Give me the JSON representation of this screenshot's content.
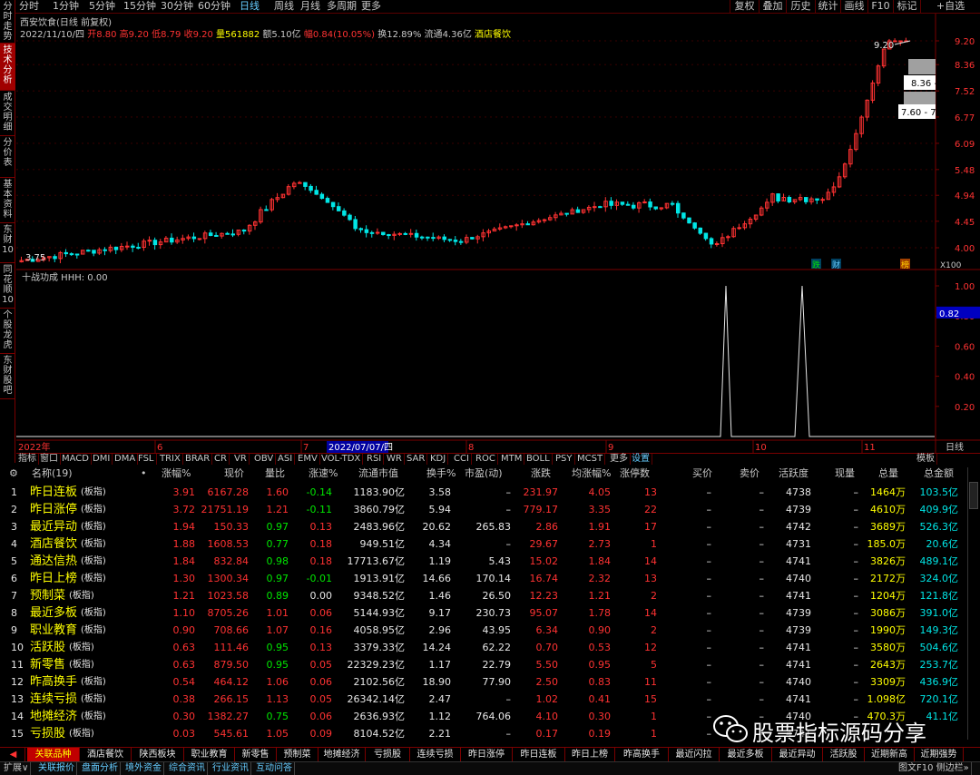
{
  "toolbar": {
    "left_tabs": [
      "分时",
      "1分钟",
      "5分钟",
      "15分钟",
      "30分钟",
      "60分钟",
      "日线",
      "周线",
      "月线",
      "多周期",
      "更多"
    ],
    "selected": "日线",
    "right_buttons": [
      "复权",
      "叠加",
      "历史",
      "统计",
      "画线",
      "F10",
      "标记",
      "+自选"
    ]
  },
  "left_tabs": [
    "分时走势",
    "技术分析",
    "成交明细",
    "分价表",
    "基本资料",
    "东财10",
    "同花顺10",
    "个股龙虎",
    "东财股吧"
  ],
  "left_tab_selected": "技术分析",
  "stock": {
    "title": "西安饮食(日线 前复权)",
    "date": "2022/11/10/四",
    "open_label": "开",
    "open": "8.80",
    "high_label": "高",
    "high": "9.20",
    "low_label": "低",
    "low": "8.79",
    "close_label": "收",
    "close": "9.20",
    "volume_label": "量",
    "volume": "561882",
    "amount_label": "额",
    "amount": "5.10亿",
    "change_label": "幅",
    "change": "0.84(10.05%)",
    "turnover_label": "换",
    "turnover": "12.89%",
    "float_label": "流通",
    "float": "4.36亿",
    "sector": "酒店餐饮"
  },
  "price_axis": [
    "9.20",
    "8.36",
    "7.52",
    "6.77",
    "6.09",
    "5.48",
    "4.94",
    "4.45",
    "4.00"
  ],
  "price_axis_note": "X100",
  "annotations": {
    "high": "9.20",
    "low": "3.75",
    "box1": "8.36 -",
    "box2": "7.60 - 7."
  },
  "markers": [
    "跌",
    "财",
    "榜"
  ],
  "indicator": {
    "title": "十战功成 HHH: 0.00",
    "axis": [
      "1.00",
      "0.82",
      "0.80",
      "0.60",
      "0.40",
      "0.20"
    ],
    "current": "0.82"
  },
  "date_axis": {
    "year": "2022年",
    "labels": [
      "6",
      "7",
      "2022/07/07/四",
      "8",
      "9",
      "10",
      "11"
    ],
    "period": "日线"
  },
  "indicator_tabs": [
    "指标",
    "窗口",
    "MACD",
    "DMI",
    "DMA",
    "FSL",
    "TRIX",
    "BRAR",
    "CR",
    "VR",
    "OBV",
    "ASI",
    "EMV",
    "VOL-TDX",
    "RSI",
    "WR",
    "SAR",
    "KDJ",
    "CCI",
    "ROC",
    "MTM",
    "BOLL",
    "PSY",
    "MCST",
    "更多",
    "设置"
  ],
  "indicator_tab_right": "模板",
  "table": {
    "headers": [
      "名称(19)",
      "•",
      "涨幅%",
      "现价",
      "量比",
      "涨速%",
      "流通市值",
      "换手%",
      "市盈(动)",
      "涨跌",
      "均涨幅%",
      "涨停数",
      "买价",
      "卖价",
      "活跃度",
      "现量",
      "总量",
      "总金额"
    ],
    "rows": [
      {
        "no": "1",
        "name": "昨日连板",
        "tag": "(板指)",
        "chg": "3.91",
        "price": "6167.28",
        "vr": "1.60",
        "speed": "-0.14",
        "mcap": "1183.90亿",
        "turn": "3.58",
        "pe": "–",
        "diff": "231.97",
        "avg": "4.05",
        "zt": "13",
        "bid": "–",
        "ask": "–",
        "act": "4738",
        "vol": "–",
        "tv": "1464万",
        "amt": "103.5亿"
      },
      {
        "no": "2",
        "name": "昨日涨停",
        "tag": "(板指)",
        "chg": "3.72",
        "price": "21751.19",
        "vr": "1.21",
        "speed": "-0.11",
        "mcap": "3860.79亿",
        "turn": "5.94",
        "pe": "–",
        "diff": "779.17",
        "avg": "3.35",
        "zt": "22",
        "bid": "–",
        "ask": "–",
        "act": "4739",
        "vol": "–",
        "tv": "4610万",
        "amt": "409.9亿"
      },
      {
        "no": "3",
        "name": "最近异动",
        "tag": "(板指)",
        "chg": "1.94",
        "price": "150.33",
        "vr": "0.97",
        "speed": "0.13",
        "mcap": "2483.96亿",
        "turn": "20.62",
        "pe": "265.83",
        "diff": "2.86",
        "avg": "1.91",
        "zt": "17",
        "bid": "–",
        "ask": "–",
        "act": "4742",
        "vol": "–",
        "tv": "3689万",
        "amt": "526.3亿"
      },
      {
        "no": "4",
        "name": "酒店餐饮",
        "tag": "(板指)",
        "chg": "1.88",
        "price": "1608.53",
        "vr": "0.77",
        "speed": "0.18",
        "mcap": "949.51亿",
        "turn": "4.34",
        "pe": "–",
        "diff": "29.67",
        "avg": "2.73",
        "zt": "1",
        "bid": "–",
        "ask": "–",
        "act": "4731",
        "vol": "–",
        "tv": "185.0万",
        "amt": "20.6亿"
      },
      {
        "no": "5",
        "name": "通达信热",
        "tag": "(板指)",
        "chg": "1.84",
        "price": "832.84",
        "vr": "0.98",
        "speed": "0.18",
        "mcap": "17713.67亿",
        "turn": "1.19",
        "pe": "5.43",
        "diff": "15.02",
        "avg": "1.84",
        "zt": "14",
        "bid": "–",
        "ask": "–",
        "act": "4741",
        "vol": "–",
        "tv": "3826万",
        "amt": "489.1亿"
      },
      {
        "no": "6",
        "name": "昨日上榜",
        "tag": "(板指)",
        "chg": "1.30",
        "price": "1300.34",
        "vr": "0.97",
        "speed": "-0.01",
        "mcap": "1913.91亿",
        "turn": "14.66",
        "pe": "170.14",
        "diff": "16.74",
        "avg": "2.32",
        "zt": "13",
        "bid": "–",
        "ask": "–",
        "act": "4740",
        "vol": "–",
        "tv": "2172万",
        "amt": "324.0亿"
      },
      {
        "no": "7",
        "name": "预制菜",
        "tag": "(板指)",
        "chg": "1.21",
        "price": "1023.58",
        "vr": "0.89",
        "speed": "0.00",
        "mcap": "9348.52亿",
        "turn": "1.46",
        "pe": "26.50",
        "diff": "12.23",
        "avg": "1.21",
        "zt": "2",
        "bid": "–",
        "ask": "–",
        "act": "4741",
        "vol": "–",
        "tv": "1204万",
        "amt": "121.8亿"
      },
      {
        "no": "8",
        "name": "最近多板",
        "tag": "(板指)",
        "chg": "1.10",
        "price": "8705.26",
        "vr": "1.01",
        "speed": "0.06",
        "mcap": "5144.93亿",
        "turn": "9.17",
        "pe": "230.73",
        "diff": "95.07",
        "avg": "1.78",
        "zt": "14",
        "bid": "–",
        "ask": "–",
        "act": "4739",
        "vol": "–",
        "tv": "3086万",
        "amt": "391.0亿"
      },
      {
        "no": "9",
        "name": "职业教育",
        "tag": "(板指)",
        "chg": "0.90",
        "price": "708.66",
        "vr": "1.07",
        "speed": "0.16",
        "mcap": "4058.95亿",
        "turn": "2.96",
        "pe": "43.95",
        "diff": "6.34",
        "avg": "0.90",
        "zt": "2",
        "bid": "–",
        "ask": "–",
        "act": "4739",
        "vol": "–",
        "tv": "1990万",
        "amt": "149.3亿"
      },
      {
        "no": "10",
        "name": "活跃股",
        "tag": "(板指)",
        "chg": "0.63",
        "price": "111.46",
        "vr": "0.95",
        "speed": "0.13",
        "mcap": "3379.33亿",
        "turn": "14.24",
        "pe": "62.22",
        "diff": "0.70",
        "avg": "0.53",
        "zt": "12",
        "bid": "–",
        "ask": "–",
        "act": "4741",
        "vol": "–",
        "tv": "3580万",
        "amt": "504.6亿"
      },
      {
        "no": "11",
        "name": "新零售",
        "tag": "(板指)",
        "chg": "0.63",
        "price": "879.50",
        "vr": "0.95",
        "speed": "0.05",
        "mcap": "22329.23亿",
        "turn": "1.17",
        "pe": "22.79",
        "diff": "5.50",
        "avg": "0.95",
        "zt": "5",
        "bid": "–",
        "ask": "–",
        "act": "4741",
        "vol": "–",
        "tv": "2643万",
        "amt": "253.7亿"
      },
      {
        "no": "12",
        "name": "昨高换手",
        "tag": "(板指)",
        "chg": "0.54",
        "price": "464.12",
        "vr": "1.06",
        "speed": "0.06",
        "mcap": "2102.56亿",
        "turn": "18.90",
        "pe": "77.90",
        "diff": "2.50",
        "avg": "0.83",
        "zt": "11",
        "bid": "–",
        "ask": "–",
        "act": "4740",
        "vol": "–",
        "tv": "3309万",
        "amt": "436.9亿"
      },
      {
        "no": "13",
        "name": "连续亏损",
        "tag": "(板指)",
        "chg": "0.38",
        "price": "266.15",
        "vr": "1.13",
        "speed": "0.05",
        "mcap": "26342.14亿",
        "turn": "2.47",
        "pe": "–",
        "diff": "1.02",
        "avg": "0.41",
        "zt": "15",
        "bid": "–",
        "ask": "–",
        "act": "4741",
        "vol": "–",
        "tv": "1.098亿",
        "amt": "720.1亿"
      },
      {
        "no": "14",
        "name": "地摊经济",
        "tag": "(板指)",
        "chg": "0.30",
        "price": "1382.27",
        "vr": "0.75",
        "speed": "0.06",
        "mcap": "2636.93亿",
        "turn": "1.12",
        "pe": "764.06",
        "diff": "4.10",
        "avg": "0.30",
        "zt": "1",
        "bid": "–",
        "ask": "–",
        "act": "4740",
        "vol": "–",
        "tv": "470.3万",
        "amt": "41.1亿"
      },
      {
        "no": "15",
        "name": "亏损股",
        "tag": "(板指)",
        "chg": "0.03",
        "price": "545.61",
        "vr": "1.05",
        "speed": "0.09",
        "mcap": "8104.52亿",
        "turn": "2.21",
        "pe": "–",
        "diff": "0.17",
        "avg": "0.19",
        "zt": "1",
        "bid": "–",
        "ask": "–",
        "act": "4741",
        "vol": "–",
        "tv": "",
        "amt": ""
      }
    ]
  },
  "sector_tabs": [
    "关联品种",
    "酒店餐饮",
    "陕西板块",
    "职业教育",
    "新零售",
    "预制菜",
    "地摊经济",
    "亏损股",
    "连续亏损",
    "昨日涨停",
    "昨日连板",
    "昨日上榜",
    "昨高换手",
    "最近闪拉",
    "最近多板",
    "最近异动",
    "活跃股",
    "近期新高",
    "近期强势"
  ],
  "sector_tab_selected": "关联品种",
  "status_bar": [
    "扩展∨",
    "关联报价",
    "盘面分析",
    "境外资金",
    "综合资讯",
    "行业资讯",
    "互动问答"
  ],
  "status_right": "图文F10 侧边栏»",
  "watermark": "股票指标源码分享",
  "colors": {
    "up": "#ff3232",
    "down": "#00e600",
    "accent": "#00e6e6",
    "border": "#7a0000"
  }
}
